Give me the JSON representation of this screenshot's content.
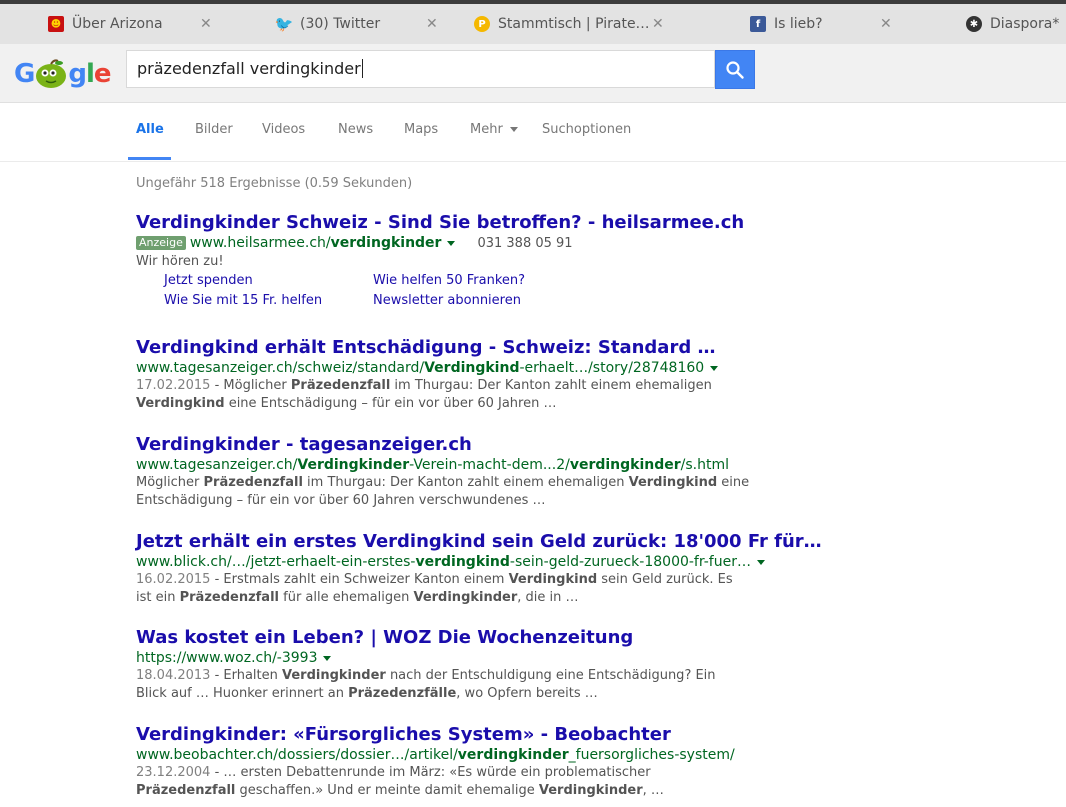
{
  "tabs": [
    {
      "label": "Über Arizona",
      "icon": "arizona-icon"
    },
    {
      "label": "(30) Twitter",
      "icon": "twitter-icon"
    },
    {
      "label": "Stammtisch | Pirate…",
      "icon": "pirate-icon"
    },
    {
      "label": "Is lieb?",
      "icon": "facebook-icon"
    },
    {
      "label": "Diaspora*",
      "icon": "diaspora-icon"
    }
  ],
  "search": {
    "query": "präzedenzfall verdingkinder",
    "logo": "Google"
  },
  "nav": [
    "Alle",
    "Bilder",
    "Videos",
    "News",
    "Maps",
    "Mehr",
    "Suchoptionen"
  ],
  "stats": "Ungefähr 518 Ergebnisse (0.59 Sekunden)",
  "ad": {
    "title": "Verdingkinder Schweiz - Sind Sie betroffen? - heilsarmee.ch",
    "badge": "Anzeige",
    "url_pre": "www.heilsarmee.ch/",
    "url_bold": "verdingkinder",
    "phone": "031 388 05 91",
    "desc": "Wir hören zu!",
    "sitelinks": [
      "Jetzt spenden",
      "Wie helfen 50 Franken?",
      "Wie Sie mit 15 Fr. helfen",
      "Newsletter abonnieren"
    ]
  },
  "results": [
    {
      "title": "Verdingkind erhält Entschädigung - Schweiz: Standard …",
      "url_parts": [
        "www.tagesanzeiger.ch/schweiz/standard/",
        "Verdingkind",
        "-erhaelt…/story/28748160"
      ],
      "date": "17.02.2015",
      "snippet_parts": [
        " - Möglicher ",
        "Präzedenzfall",
        " im Thurgau: Der Kanton zahlt einem ehemaligen ",
        "Verdingkind",
        " eine Entschädigung – für ein vor über 60 Jahren …"
      ]
    },
    {
      "title": "Verdingkinder - tagesanzeiger.ch",
      "url_parts": [
        "www.tagesanzeiger.ch/",
        "Verdingkinder",
        "-Verein-macht-dem...2/",
        "verdingkinder",
        "/s.html"
      ],
      "date": "",
      "snippet_parts": [
        "Möglicher ",
        "Präzedenzfall",
        " im Thurgau: Der Kanton zahlt einem ehemaligen ",
        "Verdingkind",
        " eine Entschädigung – für ein vor über 60 Jahren verschwundenes …"
      ]
    },
    {
      "title": "Jetzt erhält ein erstes Verdingkind sein Geld zurück: 18'000 Fr für…",
      "url_parts": [
        "www.blick.ch/…/jetzt-erhaelt-ein-erstes-",
        "verdingkind",
        "-sein-geld-zurueck-18000-fr-fuer…"
      ],
      "date": "16.02.2015",
      "snippet_parts": [
        " - Erstmals zahlt ein Schweizer Kanton einem ",
        "Verdingkind",
        " sein Geld zurück. Es ist ein ",
        "Präzedenzfall",
        " für alle ehemaligen ",
        "Verdingkinder",
        ", die in …"
      ]
    },
    {
      "title": "Was kostet ein Leben? | WOZ Die Wochenzeitung",
      "url_parts": [
        "https://www.woz.ch/-3993"
      ],
      "date": "18.04.2013",
      "snippet_parts": [
        " - Erhalten ",
        "Verdingkinder",
        " nach der Entschuldigung eine Entschädigung? Ein Blick auf … Huonker erinnert an ",
        "Präzedenzfälle",
        ", wo Opfern bereits …"
      ]
    },
    {
      "title": "Verdingkinder: «Fürsorgliches System» - Beobachter",
      "url_parts": [
        "www.beobachter.ch/dossiers/dossier…/artikel/",
        "verdingkinder",
        "_fuersorgliches-system/"
      ],
      "date": "23.12.2004",
      "snippet_parts": [
        " - … ersten Debattenrunde im März: «Es würde ein problematischer ",
        "Präzedenzfall",
        " geschaffen.» Und er meinte damit ehemalige ",
        "Verdingkinder",
        ", …"
      ]
    }
  ],
  "colors": {
    "link": "#1a0dab",
    "url": "#006621",
    "accent": "#4285f4"
  }
}
